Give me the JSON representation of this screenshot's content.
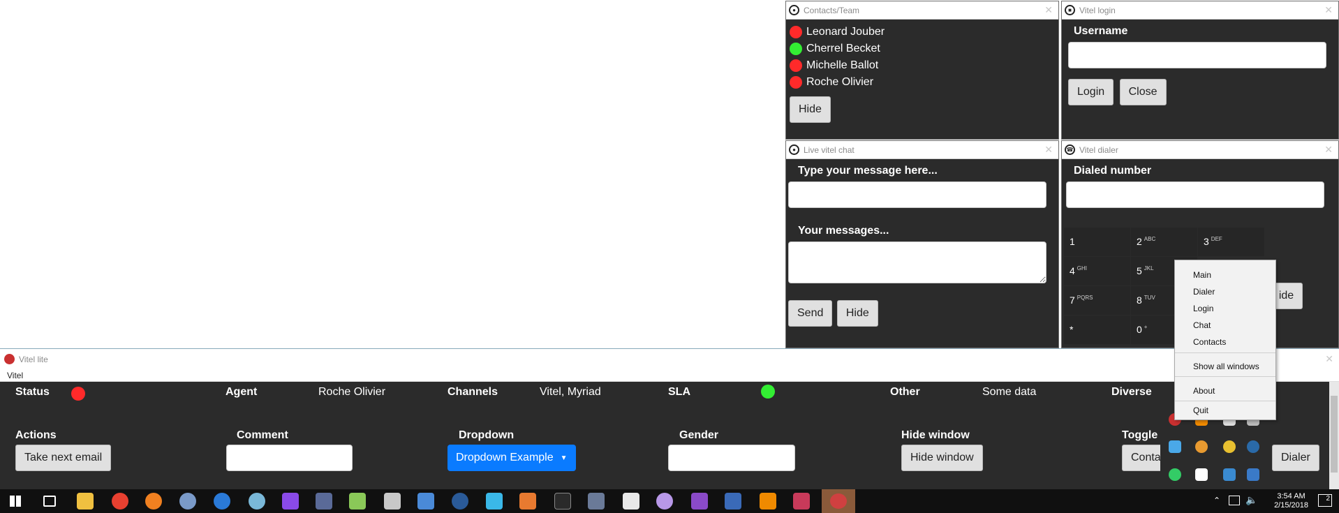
{
  "contacts_window": {
    "title": "Contacts/Team",
    "contacts": [
      {
        "name": "Leonard Jouber",
        "status_color": "#ff2a2a"
      },
      {
        "name": "Cherrel Becket",
        "status_color": "#33ee33"
      },
      {
        "name": "Michelle Ballot",
        "status_color": "#ff2a2a"
      },
      {
        "name": "Roche Olivier",
        "status_color": "#ff2a2a"
      }
    ],
    "hide_label": "Hide"
  },
  "login_window": {
    "title": "Vitel login",
    "username_label": "Username",
    "username_value": "",
    "login_label": "Login",
    "close_label": "Close"
  },
  "chat_window": {
    "title": "Live vitel chat",
    "message_label": "Type your message here...",
    "messages_label": "Your messages...",
    "send_label": "Send",
    "hide_label": "Hide"
  },
  "dialer_window": {
    "title": "Vitel dialer",
    "dialed_label": "Dialed number",
    "keys": [
      {
        "digit": "1",
        "letters": ""
      },
      {
        "digit": "2",
        "letters": "ABC"
      },
      {
        "digit": "3",
        "letters": "DEF"
      },
      {
        "digit": "4",
        "letters": "GHI"
      },
      {
        "digit": "5",
        "letters": "JKL"
      },
      {
        "digit": "7",
        "letters": "PQRS"
      },
      {
        "digit": "8",
        "letters": "TUV"
      },
      {
        "digit": "*",
        "letters": ""
      },
      {
        "digit": "0",
        "letters": "+"
      }
    ],
    "hide_partial": "ide"
  },
  "main_window": {
    "title": "Vitel lite",
    "menu": "Vitel",
    "status_label": "Status",
    "status_color": "#ff2a2a",
    "agent_label": "Agent",
    "agent_value": "Roche Olivier",
    "channels_label": "Channels",
    "channels_value": "Vitel, Myriad",
    "sla_label": "SLA",
    "sla_color": "#33ee33",
    "other_label": "Other",
    "other_value": "Some data",
    "diverse_label": "Diverse",
    "actions_label": "Actions",
    "take_next_label": "Take next email",
    "comment_label": "Comment",
    "dropdown_label": "Dropdown",
    "dropdown_button": "Dropdown Example",
    "gender_label": "Gender",
    "hide_window_label": "Hide window",
    "hide_window_button": "Hide window",
    "toggle_label": "Toggle",
    "contacts_partial": "Conta",
    "dialer_partial": "Dialer"
  },
  "context_menu": {
    "items": [
      "Main",
      "Dialer",
      "Login",
      "Chat",
      "Contacts"
    ],
    "show_all": "Show all windows",
    "about": "About",
    "quit": "Quit"
  },
  "taskbar": {
    "time": "3:54 AM",
    "date": "2/15/2018",
    "notification_count": "2"
  }
}
